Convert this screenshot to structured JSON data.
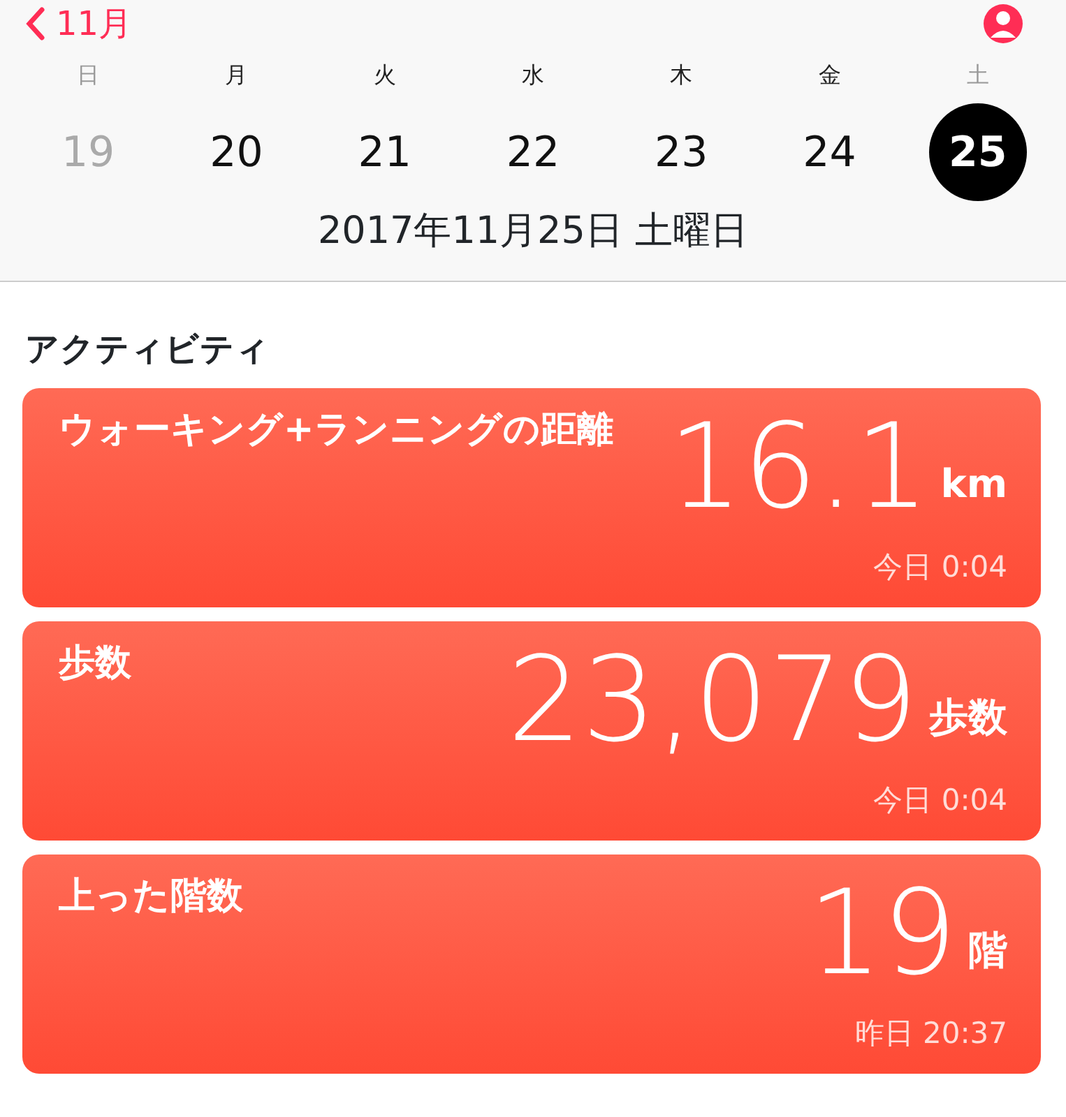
{
  "nav": {
    "back_label": "11月"
  },
  "week": [
    {
      "weekday": "日",
      "day": "19",
      "dimmed": true,
      "selected": false
    },
    {
      "weekday": "月",
      "day": "20",
      "dimmed": false,
      "selected": false
    },
    {
      "weekday": "火",
      "day": "21",
      "dimmed": false,
      "selected": false
    },
    {
      "weekday": "水",
      "day": "22",
      "dimmed": false,
      "selected": false
    },
    {
      "weekday": "木",
      "day": "23",
      "dimmed": false,
      "selected": false
    },
    {
      "weekday": "金",
      "day": "24",
      "dimmed": false,
      "selected": false
    },
    {
      "weekday": "土",
      "day": "25",
      "dimmed": true,
      "selected": true
    }
  ],
  "date_label": "2017年11月25日 土曜日",
  "section_title": "アクティビティ",
  "cards": [
    {
      "title": "ウォーキング+ランニングの距離",
      "value": "16.1",
      "unit": "km",
      "time": "今日 0:04"
    },
    {
      "title": "歩数",
      "value": "23,079",
      "unit": "歩数",
      "time": "今日 0:04"
    },
    {
      "title": "上った階数",
      "value": "19",
      "unit": "階",
      "time": "昨日 20:37"
    }
  ]
}
